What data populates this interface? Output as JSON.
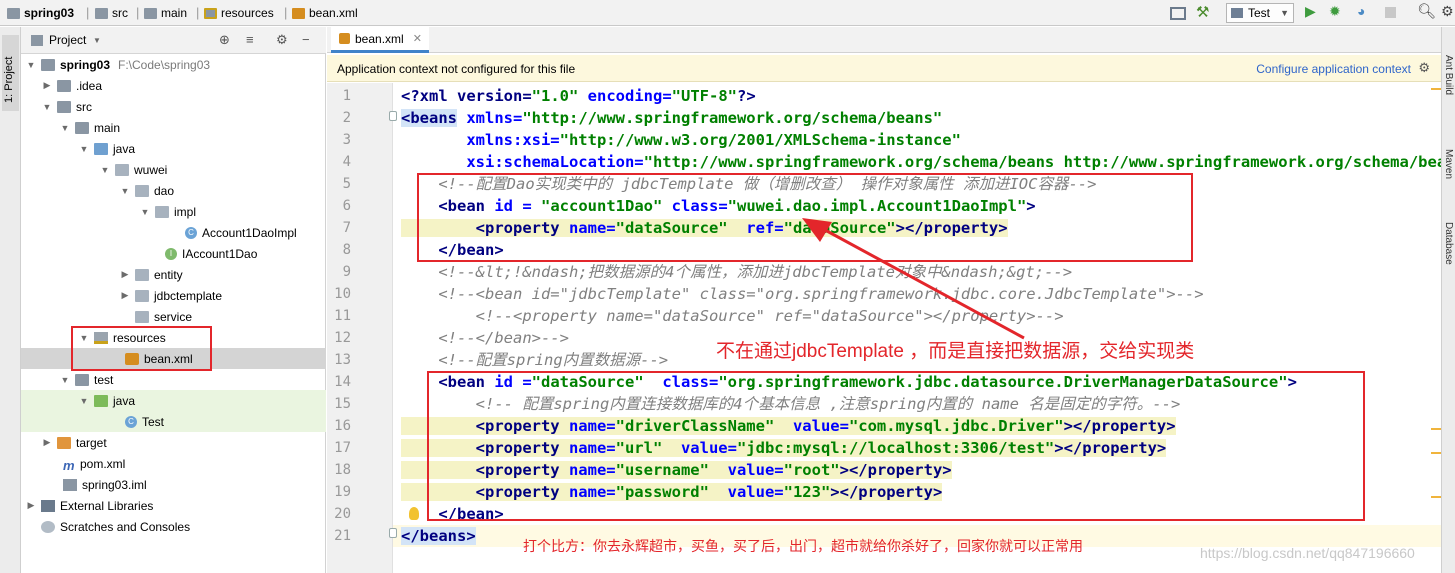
{
  "navbar": {
    "breadcrumbs": [
      "spring03",
      "src",
      "main",
      "resources",
      "bean.xml"
    ],
    "run_config": "Test"
  },
  "left_strip": {
    "project_tab": "1: Project"
  },
  "project": {
    "header": "Project",
    "root_path": "F:\\Code\\spring03",
    "tree": [
      {
        "label": "spring03",
        "icon": "folder-icon"
      },
      {
        "label": ".idea",
        "icon": "folder-icon"
      },
      {
        "label": "src",
        "icon": "folder-icon"
      },
      {
        "label": "main",
        "icon": "folder-icon"
      },
      {
        "label": "java",
        "icon": "source-folder-icon"
      },
      {
        "label": "wuwei",
        "icon": "package-icon"
      },
      {
        "label": "dao",
        "icon": "package-icon"
      },
      {
        "label": "impl",
        "icon": "package-icon"
      },
      {
        "label": "Account1DaoImpl",
        "icon": "class-icon"
      },
      {
        "label": "IAccount1Dao",
        "icon": "interface-icon"
      },
      {
        "label": "entity",
        "icon": "package-icon"
      },
      {
        "label": "jdbctemplate",
        "icon": "package-icon"
      },
      {
        "label": "service",
        "icon": "package-icon"
      },
      {
        "label": "resources",
        "icon": "resources-folder-icon"
      },
      {
        "label": "bean.xml",
        "icon": "xml-file-icon"
      },
      {
        "label": "test",
        "icon": "folder-icon"
      },
      {
        "label": "java",
        "icon": "test-source-folder-icon"
      },
      {
        "label": "Test",
        "icon": "class-icon"
      },
      {
        "label": "target",
        "icon": "target-folder-icon"
      },
      {
        "label": "pom.xml",
        "icon": "maven-icon"
      },
      {
        "label": "spring03.iml",
        "icon": "iml-file-icon"
      },
      {
        "label": "External Libraries",
        "icon": "library-icon"
      },
      {
        "label": "Scratches and Consoles",
        "icon": "scratch-icon"
      }
    ]
  },
  "editor": {
    "tab": "bean.xml",
    "banner": {
      "message": "Application context not configured for this file",
      "link": "Configure application context"
    },
    "line_numbers": [
      "1",
      "2",
      "3",
      "4",
      "5",
      "6",
      "7",
      "8",
      "9",
      "10",
      "11",
      "12",
      "13",
      "14",
      "15",
      "16",
      "17",
      "18",
      "19",
      "20",
      "21"
    ],
    "code": {
      "l1a": "<?xml version=",
      "l1b": "\"1.0\"",
      "l1c": " encoding=",
      "l1d": "\"UTF-8\"",
      "l1e": "?>",
      "l2a": "<beans",
      "l2b": " xmlns=",
      "l2c": "\"http://www.springframework.org/schema/beans\"",
      "l3a": "       xmlns:xsi=",
      "l3b": "\"http://www.w3.org/2001/XMLSchema-instance\"",
      "l4a": "       xsi:schemaLocation=",
      "l4b": "\"http://www.springframework.org/schema/beans http://www.springframework.org/schema/beans/spring-beans.xsd\"",
      "l5": "    <!--配置Dao实现类中的 jdbcTemplate 做（增删改查） 操作对象属性 添加进IOC容器-->",
      "l6a": "    <bean",
      "l6b": " id = ",
      "l6c": "\"account1Dao\"",
      "l6d": " class=",
      "l6e": "\"wuwei.dao.impl.Account1DaoImpl\"",
      "l6f": ">",
      "l7a": "        <property",
      "l7b": " name=",
      "l7c": "\"dataSource\"",
      "l7d": "  ref=",
      "l7e": "\"dataSource\"",
      "l7f": "></property>",
      "l8": "    </bean>",
      "l9": "    <!--&lt;!&ndash;把数据源的4个属性，添加进jdbcTemplate对象中&ndash;&gt;-->",
      "l10": "    <!--<bean id=\"jdbcTemplate\" class=\"org.springframework.jdbc.core.JdbcTemplate\">-->",
      "l11": "        <!--<property name=\"dataSource\" ref=\"dataSource\"></property>-->",
      "l12": "    <!--</bean>-->",
      "l13": "    <!--配置spring内置数据源-->",
      "l14a": "    <bean",
      "l14b": " id =",
      "l14c": "\"dataSource\"",
      "l14d": "  class=",
      "l14e": "\"org.springframework.jdbc.datasource.DriverManagerDataSource\"",
      "l14f": ">",
      "l15": "        <!-- 配置spring内置连接数据库的4个基本信息 ,注意spring内置的 name 名是固定的字符。-->",
      "p1a": "        <property",
      "p1b": " name=",
      "p1c": "\"driverClassName\"",
      "p1d": "  value=",
      "p1e": "\"com.mysql.jdbc.Driver\"",
      "p1f": "></property>",
      "p2c": "\"url\"",
      "p2e": "\"jdbc:mysql://localhost:3306/test\"",
      "p3c": "\"username\"",
      "p3e": "\"root\"",
      "p4c": "\"password\"",
      "p4e": "\"123\"",
      "l20": "    </bean>",
      "l21": "</beans>"
    }
  },
  "annotations": {
    "note_top": "不在通过jdbcTemplate ，而是直接把数据源，交给实现类",
    "note_bottom": "打个比方：你去永辉超市，买鱼，买了后，出门，超市就给你杀好了，回家你就可以正常用",
    "watermark": "https://blog.csdn.net/qq847196660"
  },
  "right_strip": {
    "tabs": [
      "Ant Build",
      "Maven",
      "Database"
    ]
  },
  "colors": {
    "annotation_red": "#e3262b",
    "tag": "#000080",
    "attr_value": "#008000",
    "comment": "#808080"
  }
}
